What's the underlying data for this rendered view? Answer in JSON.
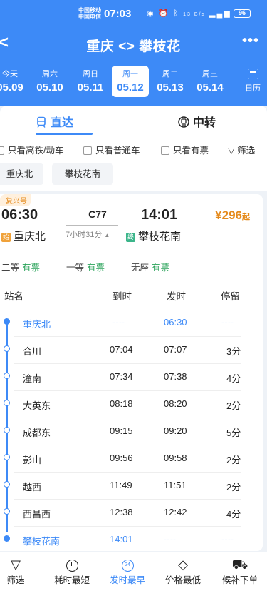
{
  "status": {
    "carrier_line1": "中国移动",
    "carrier_line2": "中国电信",
    "time": "07:03",
    "net_speed": "13 B/s",
    "battery": "96"
  },
  "nav": {
    "title": "重庆 <> 攀枝花"
  },
  "dates": [
    {
      "weekday": "今天",
      "date": "05.09"
    },
    {
      "weekday": "周六",
      "date": "05.10"
    },
    {
      "weekday": "周日",
      "date": "05.11"
    },
    {
      "weekday": "周一",
      "date": "05.12"
    },
    {
      "weekday": "周二",
      "date": "05.13"
    },
    {
      "weekday": "周三",
      "date": "05.14"
    }
  ],
  "calendar_label": "日历",
  "tabs": {
    "direct": "直达",
    "transfer": "中转"
  },
  "filters": {
    "gaotie": "只看高铁/动车",
    "putong": "只看普通车",
    "youpiao": "只看有票",
    "shaixuan": "筛选"
  },
  "station_chips": [
    "重庆北",
    "攀枝花南"
  ],
  "train": {
    "badge": "复兴号",
    "dep_time": "06:30",
    "arr_time": "14:01",
    "number": "C77",
    "duration": "7小时31分",
    "price": "¥296",
    "price_suffix": "起",
    "dep_station": "重庆北",
    "dep_tag": "始",
    "arr_station": "攀枝花南",
    "arr_tag": "终",
    "seats": [
      {
        "class": "二等",
        "status": "有票"
      },
      {
        "class": "一等",
        "status": "有票"
      },
      {
        "class": "无座",
        "status": "有票"
      }
    ]
  },
  "stops_header": {
    "name": "站名",
    "arrive": "到时",
    "depart": "发时",
    "stay": "停留"
  },
  "stops": [
    {
      "name": "重庆北",
      "arrive": "----",
      "depart": "06:30",
      "stay": "----"
    },
    {
      "name": "合川",
      "arrive": "07:04",
      "depart": "07:07",
      "stay": "3分"
    },
    {
      "name": "潼南",
      "arrive": "07:34",
      "depart": "07:38",
      "stay": "4分"
    },
    {
      "name": "大英东",
      "arrive": "08:18",
      "depart": "08:20",
      "stay": "2分"
    },
    {
      "name": "成都东",
      "arrive": "09:15",
      "depart": "09:20",
      "stay": "5分"
    },
    {
      "name": "彭山",
      "arrive": "09:56",
      "depart": "09:58",
      "stay": "2分"
    },
    {
      "name": "越西",
      "arrive": "11:49",
      "depart": "11:51",
      "stay": "2分"
    },
    {
      "name": "西昌西",
      "arrive": "12:38",
      "depart": "12:42",
      "stay": "4分"
    },
    {
      "name": "攀枝花南",
      "arrive": "14:01",
      "depart": "----",
      "stay": "----"
    }
  ],
  "bottom": {
    "filter": "筛选",
    "shortest": "耗时最短",
    "earliest": "发时最早",
    "cheapest": "价格最低",
    "waitlist": "候补下单"
  },
  "colors": {
    "primary": "#3d8af7",
    "price": "#e58a1b",
    "available": "#2aa35a"
  }
}
